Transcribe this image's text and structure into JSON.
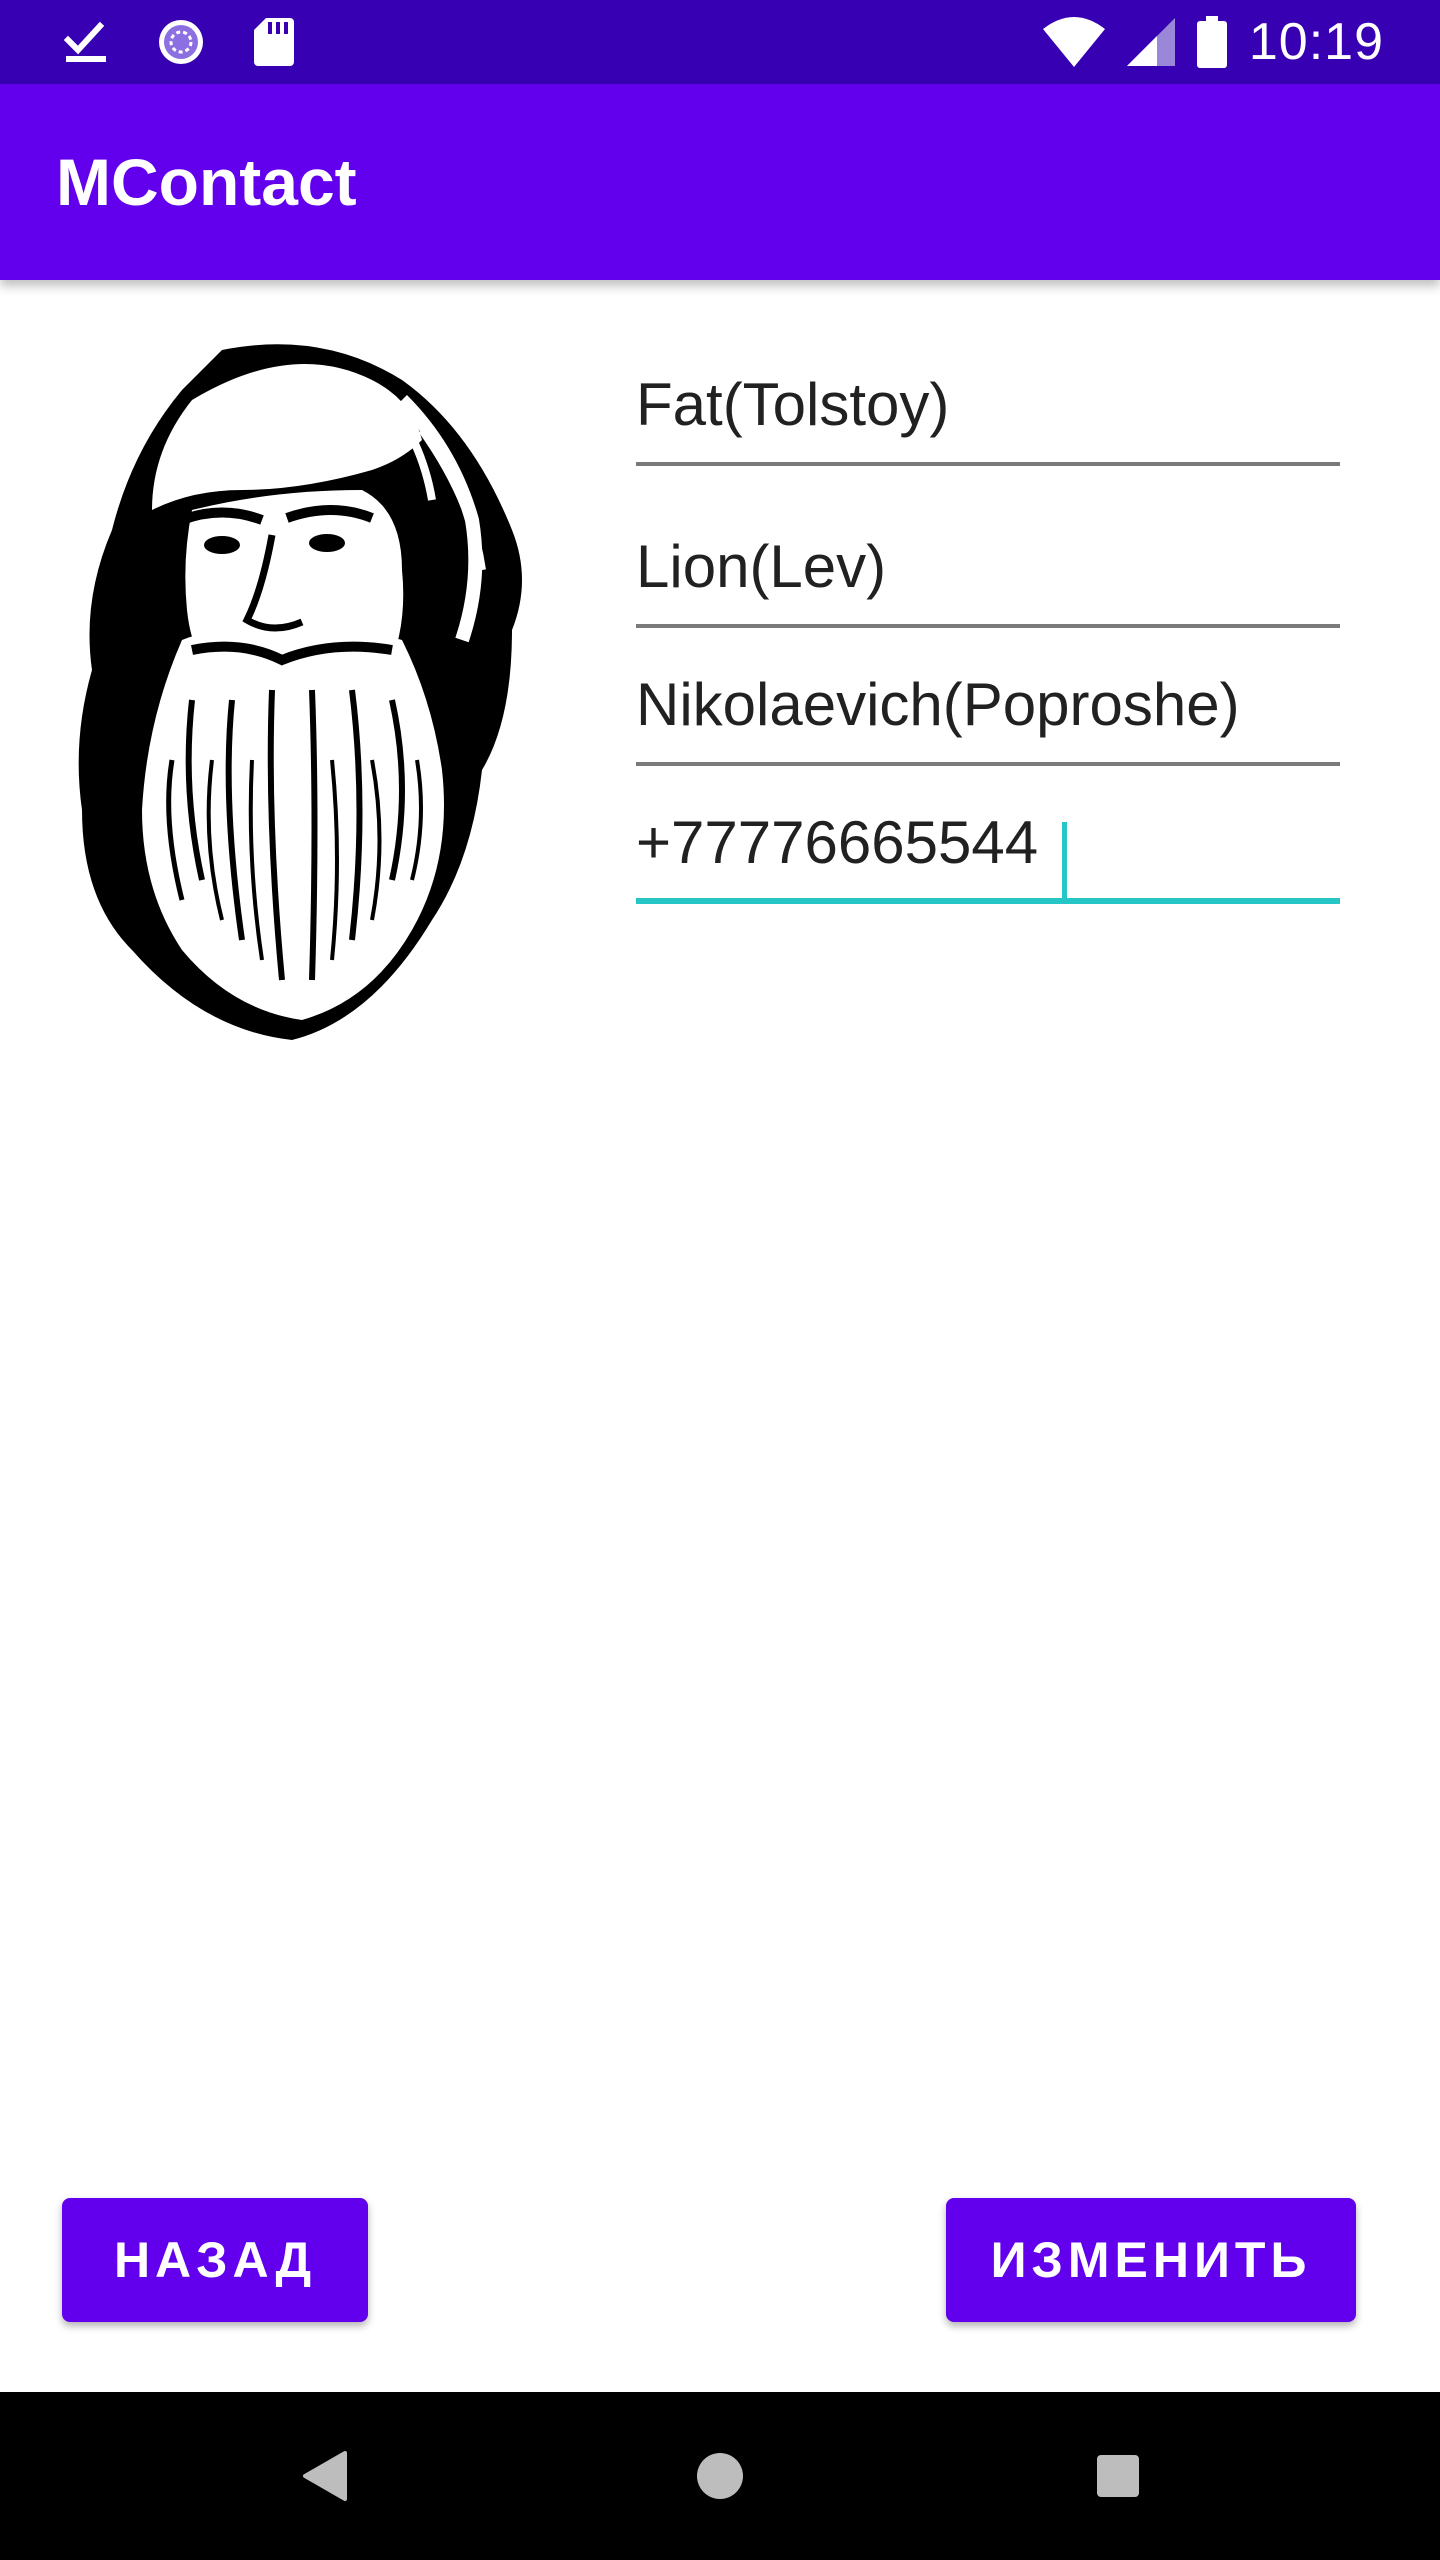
{
  "status_bar": {
    "time": "10:19",
    "icons_left": [
      "download-done-icon",
      "sync-progress-icon",
      "sd-card-icon"
    ],
    "icons_right": [
      "wifi-icon",
      "cell-signal-icon",
      "battery-icon"
    ],
    "background_color": "#3700b3"
  },
  "app_bar": {
    "title": "MContact",
    "background_color": "#6200ee"
  },
  "contact": {
    "photo": "bearded-man-portrait",
    "fields": [
      {
        "name": "last-name",
        "value": "Fat(Tolstoy)"
      },
      {
        "name": "first-name",
        "value": "Lion(Lev)"
      },
      {
        "name": "middle-name",
        "value": "Nikolaevich(Poproshe)"
      },
      {
        "name": "phone",
        "value": "+77776665544",
        "focused": true
      }
    ]
  },
  "buttons": {
    "back_label": "НАЗАД",
    "edit_label": "ИЗМЕНИТЬ",
    "color": "#6200ee"
  },
  "nav_bar": {
    "icons": [
      "back-triangle-icon",
      "home-circle-icon",
      "recents-square-icon"
    ]
  },
  "accent_color": "#26c6c6"
}
